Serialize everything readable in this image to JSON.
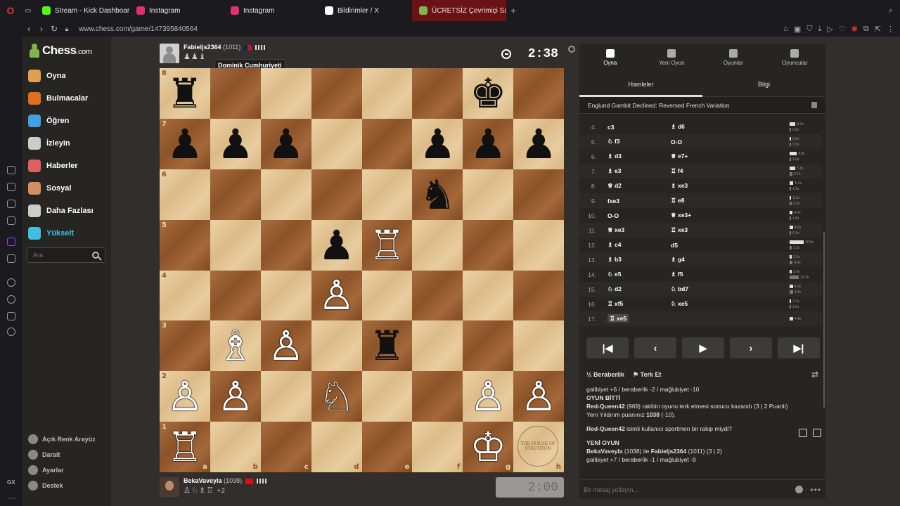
{
  "browser": {
    "tabs": [
      {
        "label": "Stream - Kick Dashboard",
        "icon": "kick-icon",
        "color": "#53fc18"
      },
      {
        "label": "Instagram",
        "icon": "instagram-icon",
        "color": "#e1306c"
      },
      {
        "label": "Instagram",
        "icon": "instagram-icon",
        "color": "#e1306c"
      },
      {
        "label": "Bildirimler / X",
        "icon": "x-icon",
        "color": "#ffffff"
      },
      {
        "label": "ÜCRETSİZ Çevrimiçi Satra",
        "icon": "chess-icon",
        "color": "#81b64c"
      }
    ],
    "url": "www.chess.com/game/147395840564"
  },
  "sidebar": {
    "logo": "Chess",
    "logo_suffix": ".com",
    "items": [
      {
        "label": "Oyna",
        "icon": "play-icon",
        "color": "#e0a050"
      },
      {
        "label": "Bulmacalar",
        "icon": "puzzle-icon",
        "color": "#e07020"
      },
      {
        "label": "Öğren",
        "icon": "learn-icon",
        "color": "#40a0e0"
      },
      {
        "label": "İzleyin",
        "icon": "watch-icon",
        "color": "#cccccc"
      },
      {
        "label": "Haberler",
        "icon": "news-icon",
        "color": "#e06060"
      },
      {
        "label": "Sosyal",
        "icon": "social-icon",
        "color": "#d09060"
      },
      {
        "label": "Daha Fazlası",
        "icon": "more-icon",
        "color": "#cccccc"
      },
      {
        "label": "Yükselt",
        "icon": "diamond-icon",
        "color": "#40c0e0"
      }
    ],
    "search_placeholder": "Ara",
    "footer": [
      {
        "label": "Açık Renk Arayüz",
        "icon": "theme-icon"
      },
      {
        "label": "Daralt",
        "icon": "collapse-icon"
      },
      {
        "label": "Ayarlar",
        "icon": "settings-icon"
      },
      {
        "label": "Destek",
        "icon": "help-icon"
      }
    ]
  },
  "top_player": {
    "name": "Fabieljs2364",
    "rating": "(1011)",
    "captured": "♟♟♝",
    "tooltip": "Dominik Cumhuriyeti"
  },
  "bottom_player": {
    "name": "BekaVaveyla",
    "rating": "(1038)",
    "captured": "♙♘♗♖",
    "advantage": "+2"
  },
  "clocks": {
    "top": "2:38",
    "bottom": "2:00"
  },
  "board": [
    [
      "r",
      "",
      "",
      "",
      "",
      "",
      "k",
      ""
    ],
    [
      "p",
      "p",
      "p",
      "",
      "",
      "p",
      "p",
      "p"
    ],
    [
      "",
      "",
      "",
      "",
      "",
      "n",
      "",
      ""
    ],
    [
      "",
      "",
      "",
      "p",
      "R",
      "",
      "",
      ""
    ],
    [
      "",
      "",
      "",
      "P",
      "",
      "",
      "",
      ""
    ],
    [
      "",
      "B",
      "P",
      "",
      "r",
      "",
      "",
      ""
    ],
    [
      "P",
      "P",
      "",
      "N",
      "",
      "",
      "P",
      "P"
    ],
    [
      "R",
      "",
      "",
      "",
      "",
      "",
      "K",
      ""
    ]
  ],
  "files": [
    "a",
    "b",
    "c",
    "d",
    "e",
    "f",
    "g",
    "h"
  ],
  "ranks": [
    "8",
    "7",
    "6",
    "5",
    "4",
    "3",
    "2",
    "1"
  ],
  "stamp_text": "THE HOUSE OF STAUNTON",
  "panel": {
    "tabs": [
      {
        "label": "Oyna",
        "icon": "play-bolt-icon"
      },
      {
        "label": "Yeni Oyun",
        "icon": "new-game-icon"
      },
      {
        "label": "Oyunlar",
        "icon": "games-icon"
      },
      {
        "label": "Oyuncular",
        "icon": "players-icon"
      }
    ],
    "subtabs": [
      "Hamleler",
      "Bilgi"
    ],
    "opening": "Englund Gambit Declined: Reversed French Variation",
    "moves": [
      {
        "n": "4.",
        "w": "c3",
        "b": "♗ d6",
        "tw": "8.0s",
        "tb": "0.5s",
        "fw": 0.42,
        "fb": 0.03
      },
      {
        "n": "5.",
        "w": "♘ f3",
        "b": "O-O",
        "tw": "0.6s",
        "tb": "1.9s",
        "fw": 0.03,
        "fb": 0.1
      },
      {
        "n": "6.",
        "w": "♗ d3",
        "b": "♕ e7+",
        "tw": "9.8s",
        "tb": "1.8s",
        "fw": 0.52,
        "fb": 0.1
      },
      {
        "n": "7.",
        "w": "♗ e3",
        "b": "♖ f4",
        "tw": "7.3s",
        "tb": "3.7s",
        "fw": 0.38,
        "fb": 0.2
      },
      {
        "n": "8.",
        "w": "♕ d2",
        "b": "♗ xe3",
        "tw": "5.1s",
        "tb": "1.9s",
        "fw": 0.27,
        "fb": 0.1
      },
      {
        "n": "9.",
        "w": "fxe3",
        "b": "♖ e8",
        "tw": "2.3s",
        "tb": "2.6s",
        "fw": 0.12,
        "fb": 0.14
      },
      {
        "n": "10.",
        "w": "O-O",
        "b": "♕ xe3+",
        "tw": "4.0s",
        "tb": "1.8s",
        "fw": 0.21,
        "fb": 0.1
      },
      {
        "n": "11.",
        "w": "♕ xe3",
        "b": "♖ xe3",
        "tw": "4.6s",
        "tb": "0.1s",
        "fw": 0.24,
        "fb": 0.01
      },
      {
        "n": "12.",
        "w": "♗ c4",
        "b": "d5",
        "tw": "19.0s",
        "tb": "3.3s",
        "fw": 1.0,
        "fb": 0.17
      },
      {
        "n": "13.",
        "w": "♗ b3",
        "b": "♗ g4",
        "tw": "3.1s",
        "tb": "4.0s",
        "fw": 0.16,
        "fb": 0.21
      },
      {
        "n": "14.",
        "w": "♘ e5",
        "b": "♗ f5",
        "tw": "2.9s",
        "tb": "12.3s",
        "fw": 0.15,
        "fb": 0.65
      },
      {
        "n": "15.",
        "w": "♘ d2",
        "b": "♘ bd7",
        "tw": "4.3s",
        "tb": "4.4s",
        "fw": 0.23,
        "fb": 0.23
      },
      {
        "n": "16.",
        "w": "♖ xf5",
        "b": "♘ xe5",
        "tw": "2.1s",
        "tb": "1.6s",
        "fw": 0.11,
        "fb": 0.08
      },
      {
        "n": "17.",
        "w": "♖ xe5",
        "b": "",
        "tw": "4.4s",
        "tb": "",
        "fw": 0.23,
        "fb": 0
      }
    ],
    "draw_label": "Beraberlik",
    "resign_label": "Terk Et",
    "chat": {
      "line1": "galibiyet +6 / beraberlik -2 / mağlubiyet -10",
      "game_over": "OYUN BİTTİ",
      "result_name": "Red-Queen42",
      "result_text": " (969) rakibin oyunu terk etmesi sonucu kazandı (3 | 2 Puanlı)",
      "rating_line": "Yeni Yıldırım puanınız ",
      "rating_value": "1038",
      "rating_delta": " (-10).",
      "question_name": "Red-Queen42",
      "question_text": " isimli kullanıcı sportmen bir rakip miydi?",
      "new_game": "YENİ OYUN",
      "ng_p1": "BekaVaveyla",
      "ng_mid": " (1038) ile ",
      "ng_p2": "Fabieljs2364",
      "ng_tail": " (1011) (3 | 2)",
      "line_last": "galibiyet +7 / beraberlik -1 / mağlubiyet -9"
    },
    "message_placeholder": "Bir mesaj yollayın..."
  }
}
